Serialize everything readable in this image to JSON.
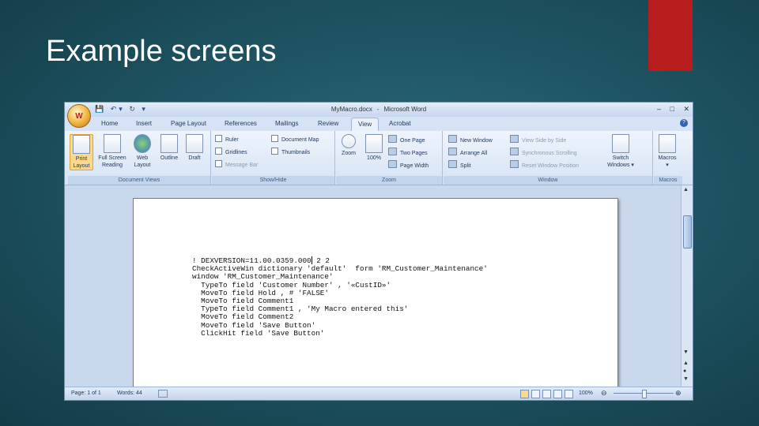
{
  "slide": {
    "title": "Example screens"
  },
  "window": {
    "title_file": "MyMacro.docx",
    "title_sep": "-",
    "title_app": "Microsoft Word",
    "office_button_glyph": "W",
    "controls": {
      "minimize": "–",
      "maximize": "□",
      "close": "✕"
    },
    "help": "?"
  },
  "quick_access": {
    "save_icon": "save-icon",
    "undo": "↶▾",
    "redo": "↻",
    "customize": "▾"
  },
  "tabs": [
    "Home",
    "Insert",
    "Page Layout",
    "References",
    "Mailings",
    "Review",
    "View",
    "Acrobat"
  ],
  "active_tab": "View",
  "ribbon": {
    "document_views": {
      "label": "Document Views",
      "buttons": [
        {
          "line1": "Print",
          "line2": "Layout"
        },
        {
          "line1": "Full Screen",
          "line2": "Reading"
        },
        {
          "line1": "Web",
          "line2": "Layout"
        },
        {
          "line1": "Outline",
          "line2": ""
        },
        {
          "line1": "Draft",
          "line2": ""
        }
      ]
    },
    "show_hide": {
      "label": "Show/Hide",
      "ruler": "Ruler",
      "gridlines": "Gridlines",
      "message_bar": "Message Bar",
      "document_map": "Document Map",
      "thumbnails": "Thumbnails"
    },
    "zoom": {
      "label": "Zoom",
      "zoom": "Zoom",
      "hundred": "100%",
      "one_page": "One Page",
      "two_pages": "Two Pages",
      "page_width": "Page Width"
    },
    "window": {
      "label": "Window",
      "new_window": "New Window",
      "arrange_all": "Arrange All",
      "split": "Split",
      "view_side": "View Side by Side",
      "sync_scroll": "Synchronous Scrolling",
      "reset_pos": "Reset Window Position",
      "switch_line1": "Switch",
      "switch_line2": "Windows ▾"
    },
    "macros": {
      "label": "Macros",
      "button_line1": "Macros",
      "button_line2": "▾"
    }
  },
  "document": {
    "lines": [
      "! DEXVERSION=11.00.0359.000",
      "CheckActiveWin dictionary 'default'  form 'RM_Customer_Maintenance'",
      "window 'RM_Customer_Maintenance'",
      "  TypeTo field 'Customer Number' , '«CustID»'",
      "  MoveTo field Hold , # 'FALSE'",
      "  MoveTo field Comment1",
      "  TypeTo field Comment1 , 'My Macro entered this'",
      "  MoveTo field Comment2",
      "  MoveTo field 'Save Button'",
      "  ClickHit field 'Save Button'"
    ],
    "line0_suffix": " 2 2"
  },
  "status": {
    "page": "Page: 1 of 1",
    "words": "Words: 44",
    "zoom": "100%",
    "minus": "⊖",
    "plus": "⊕"
  },
  "scrollbar": {
    "up": "▲",
    "down": "▼",
    "prev": "▲",
    "select": "●",
    "next": "▼"
  },
  "ruler_toggle": "⊞"
}
